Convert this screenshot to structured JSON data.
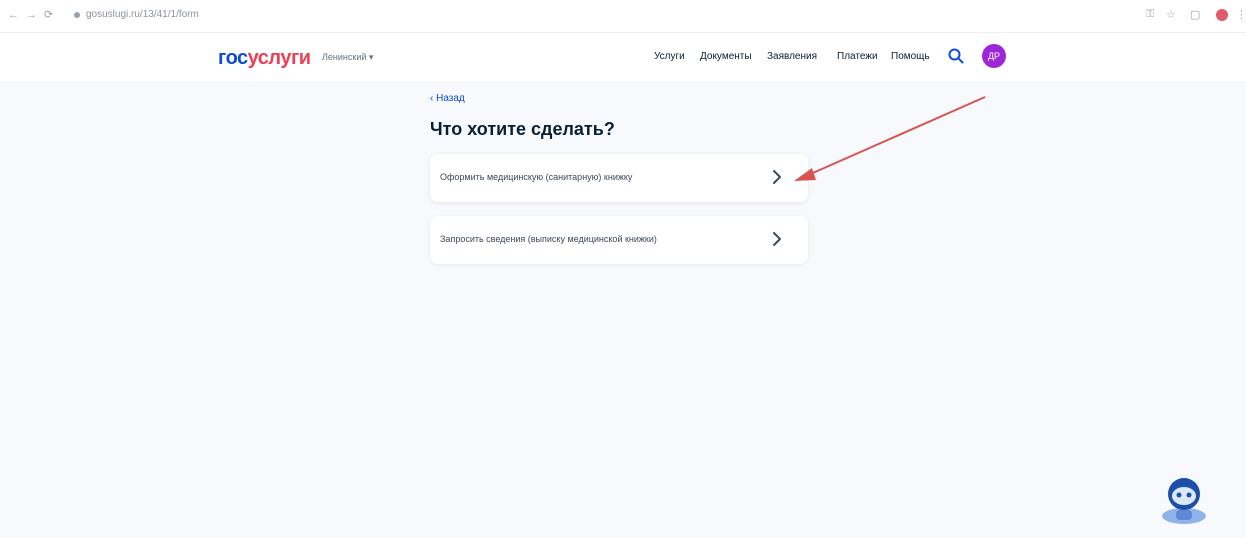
{
  "browser": {
    "back": "←",
    "forward": "→",
    "reload": "⟳",
    "url": "gosuslugi.ru/13/41/1/form",
    "icons": [
      "key-icon",
      "star-icon",
      "tab-icon",
      "profile-icon"
    ]
  },
  "header": {
    "logo_part1": "гос",
    "logo_part2": "услуги",
    "location": "Ленинский ▾",
    "nav": [
      "Услуги",
      "Документы",
      "Заявления",
      "Платежи",
      "Помощь"
    ],
    "avatar_initials": "ДР"
  },
  "main": {
    "back_link": "‹ Назад",
    "title": "Что хотите сделать?",
    "options": [
      {
        "label": "Оформить медицинскую (санитарную) книжку"
      },
      {
        "label": "Запросить сведения (выписку медицинской книжки)"
      }
    ]
  },
  "colors": {
    "brand_blue": "#0d4cd3",
    "brand_red": "#ee3f58",
    "avatar": "#9b27d6",
    "arrow": "#d9534f"
  }
}
